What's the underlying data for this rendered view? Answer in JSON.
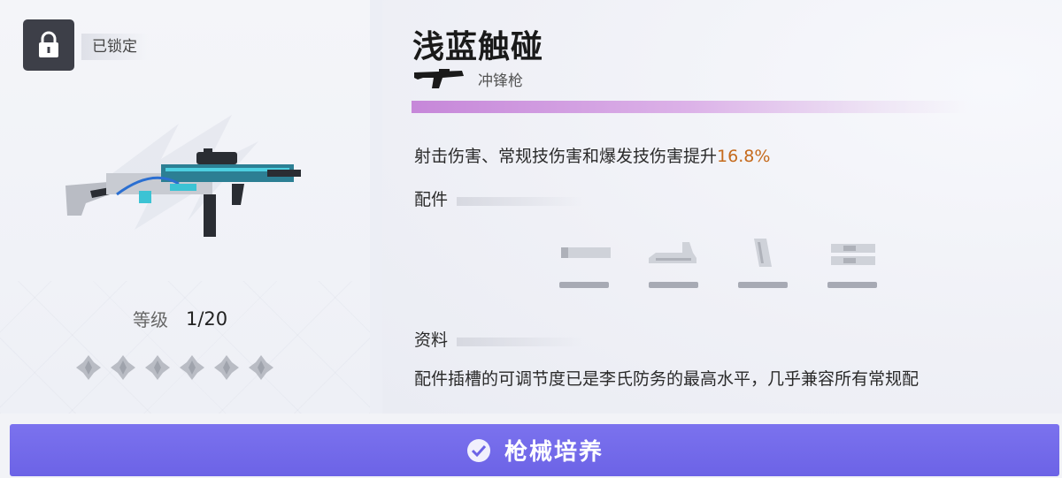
{
  "status": {
    "lock_label": "已锁定"
  },
  "weapon": {
    "name": "浅蓝触碰",
    "type": "冲锋枪",
    "level_label": "等级",
    "level_value": "1/20",
    "stars_total": 6,
    "stars_filled": 0,
    "rarity_color": "#c687d9"
  },
  "effect": {
    "text": "射击伤害、常规技伤害和爆发技伤害提升",
    "value": "16.8%"
  },
  "sections": {
    "attachments_title": "配件",
    "info_title": "资料"
  },
  "attachments": [
    {
      "icon": "muzzle-icon"
    },
    {
      "icon": "sight-icon"
    },
    {
      "icon": "magazine-icon"
    },
    {
      "icon": "grip-icon"
    }
  ],
  "info": {
    "text": "配件插槽的可调节度已是李氏防务的最高水平，几乎兼容所有常规配"
  },
  "action": {
    "train_label": "枪械培养"
  },
  "colors": {
    "accent": "#7b72ee",
    "highlight": "#c56a1c"
  }
}
